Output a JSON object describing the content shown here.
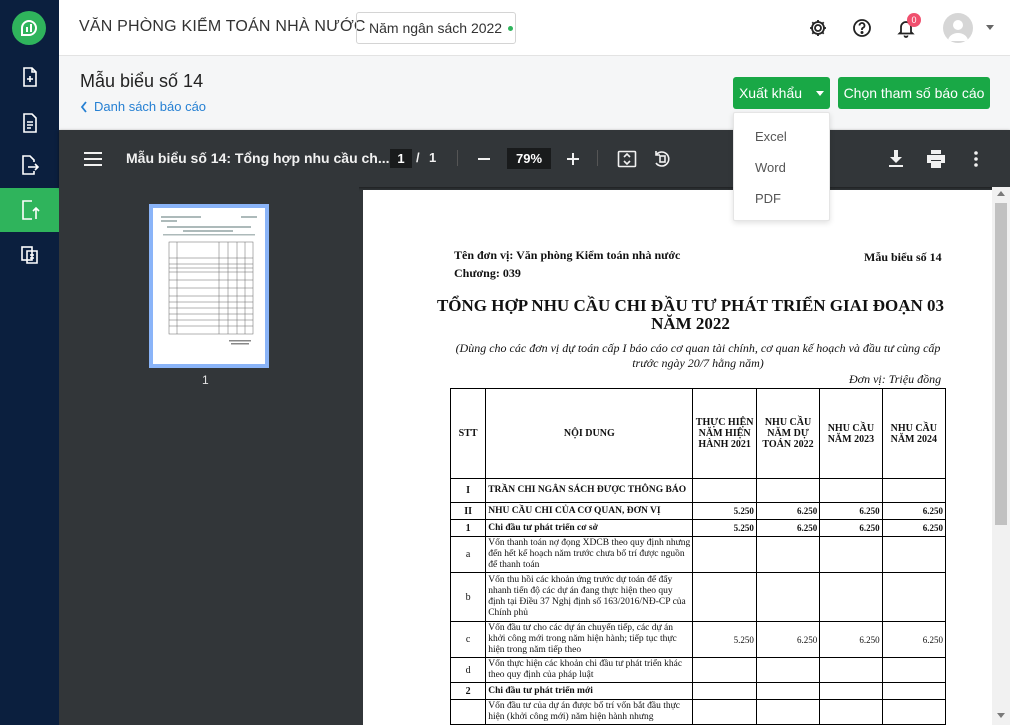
{
  "rail": {
    "items": [
      "add-document",
      "document",
      "export-document",
      "upload-document",
      "copy-document"
    ],
    "active_index": 3
  },
  "topbar": {
    "org_name": "VĂN PHÒNG KIỂM TOÁN NHÀ NƯỚC",
    "budget_year": "Năm ngân sách 2022",
    "notification_count": "0"
  },
  "header": {
    "title": "Mẫu biểu số 14",
    "back_link": "Danh sách báo cáo",
    "export_label": "Xuất khẩu",
    "params_label": "Chọn tham số báo cáo"
  },
  "export_menu": {
    "items": [
      "Excel",
      "Word",
      "PDF"
    ]
  },
  "viewer": {
    "doc_title": "Mẫu biểu số 14: Tổng hợp nhu cầu ch...",
    "page_current": "1",
    "page_sep": "/",
    "page_total": "1",
    "zoom": "79%",
    "thumb_page": "1"
  },
  "report": {
    "unit_name": "Tên đơn vị: Văn phòng Kiểm toán nhà nước",
    "chapter": "Chương: 039",
    "form_no": "Mẫu biểu số 14",
    "title_line1": "TỔNG HỢP NHU CẦU CHI ĐẦU TƯ PHÁT TRIỂN GIAI ĐOẠN 03",
    "title_line2": "NĂM 2022",
    "subtitle": "(Dùng cho các đơn vị dự toán cấp I báo cáo cơ quan tài chính, cơ quan kế hoạch và đầu tư cùng cấp trước ngày 20/7 hằng năm)",
    "currency_unit": "Đơn vị: Triệu đồng",
    "columns": [
      "STT",
      "NỘI DUNG",
      "THỰC HIỆN NĂM HIỆN HÀNH 2021",
      "NHU CẦU NĂM DỰ TOÁN 2022",
      "NHU CẦU NĂM 2023",
      "NHU CẦU NĂM 2024"
    ],
    "rows": [
      {
        "stt": "I",
        "content": "TRẦN CHI NGÂN SÁCH  ĐƯỢC THÔNG BÁO",
        "v1": "",
        "v2": "",
        "v3": "",
        "v4": "",
        "bold": true
      },
      {
        "stt": "II",
        "content": "NHU CẦU CHI CỦA CƠ QUAN, ĐƠN VỊ",
        "v1": "5.250",
        "v2": "6.250",
        "v3": "6.250",
        "v4": "6.250",
        "bold": true
      },
      {
        "stt": "1",
        "content": "Chi đầu tư phát triển cơ sở",
        "v1": "5.250",
        "v2": "6.250",
        "v3": "6.250",
        "v4": "6.250",
        "bold": true
      },
      {
        "stt": "a",
        "content": "Vốn thanh toán nợ đọng XDCB theo quy định nhưng đến hết kế hoạch năm trước chưa bố trí được nguồn để thanh toán",
        "v1": "",
        "v2": "",
        "v3": "",
        "v4": "",
        "bold": false
      },
      {
        "stt": "b",
        "content": "Vốn thu hồi các khoản ứng trước dự toán để đẩy nhanh tiến độ các dự án đang thực hiện theo quy định tại Điều 37 Nghị định số 163/2016/NĐ-CP của Chính phủ",
        "v1": "",
        "v2": "",
        "v3": "",
        "v4": "",
        "bold": false
      },
      {
        "stt": "c",
        "content": "Vốn đầu tư cho các dự án chuyển tiếp, các dự án khởi công mới trong năm hiện hành; tiếp tục thực hiện trong năm tiếp theo",
        "v1": "5.250",
        "v2": "6.250",
        "v3": "6.250",
        "v4": "6.250",
        "bold": false
      },
      {
        "stt": "d",
        "content": "Vốn thực hiện các khoản chi đầu tư phát triển khác theo quy định của pháp luật",
        "v1": "",
        "v2": "",
        "v3": "",
        "v4": "",
        "bold": false
      },
      {
        "stt": "2",
        "content": "Chi đầu tư phát triển mới",
        "v1": "",
        "v2": "",
        "v3": "",
        "v4": "",
        "bold": true
      },
      {
        "stt": "",
        "content": "Vốn đầu tư của dự án được bố trí vốn bắt đầu thực hiện (khởi công mới) năm hiện hành nhưng",
        "v1": "",
        "v2": "",
        "v3": "",
        "v4": "",
        "bold": false
      }
    ]
  },
  "colors": {
    "rail": "#0b1f3e",
    "accent": "#19a846",
    "link": "#2680d3",
    "viewer_bg": "#323639"
  }
}
